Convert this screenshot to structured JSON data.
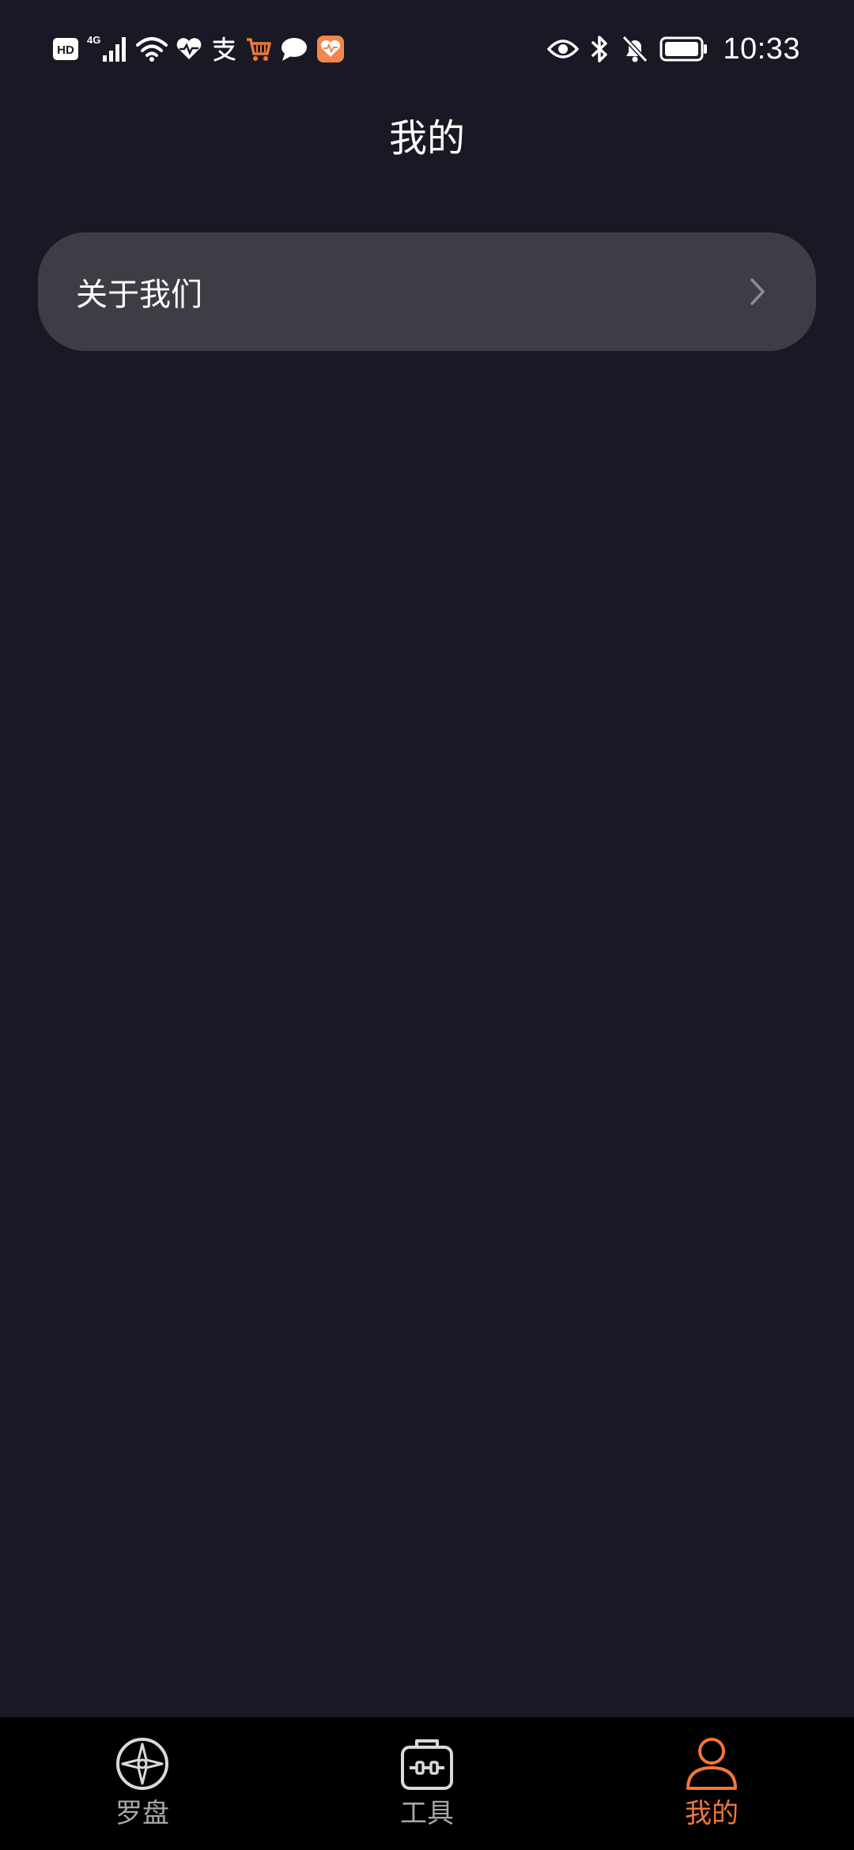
{
  "status_bar": {
    "time": "10:33",
    "left_icons": [
      "hd-icon",
      "signal-4g-icon",
      "wifi-icon",
      "health-icon",
      "alipay-icon",
      "taobao-icon",
      "message-icon",
      "app-icon"
    ],
    "right_icons": [
      "eye-icon",
      "bluetooth-icon",
      "bell-off-icon",
      "battery-icon"
    ],
    "network_label": "4G",
    "hd_label": "HD"
  },
  "header": {
    "title": "我的"
  },
  "menu": {
    "items": [
      {
        "label": "关于我们",
        "icon": "chevron-right-icon"
      }
    ]
  },
  "bottom_nav": {
    "active_index": 2,
    "accent_color": "#f07838",
    "inactive_color": "#a7a7a9",
    "items": [
      {
        "label": "罗盘",
        "icon": "compass-icon"
      },
      {
        "label": "工具",
        "icon": "toolbox-icon"
      },
      {
        "label": "我的",
        "icon": "user-icon"
      }
    ]
  },
  "colors": {
    "background": "#181924",
    "card": "#3d3e45",
    "nav_background": "#000000"
  }
}
